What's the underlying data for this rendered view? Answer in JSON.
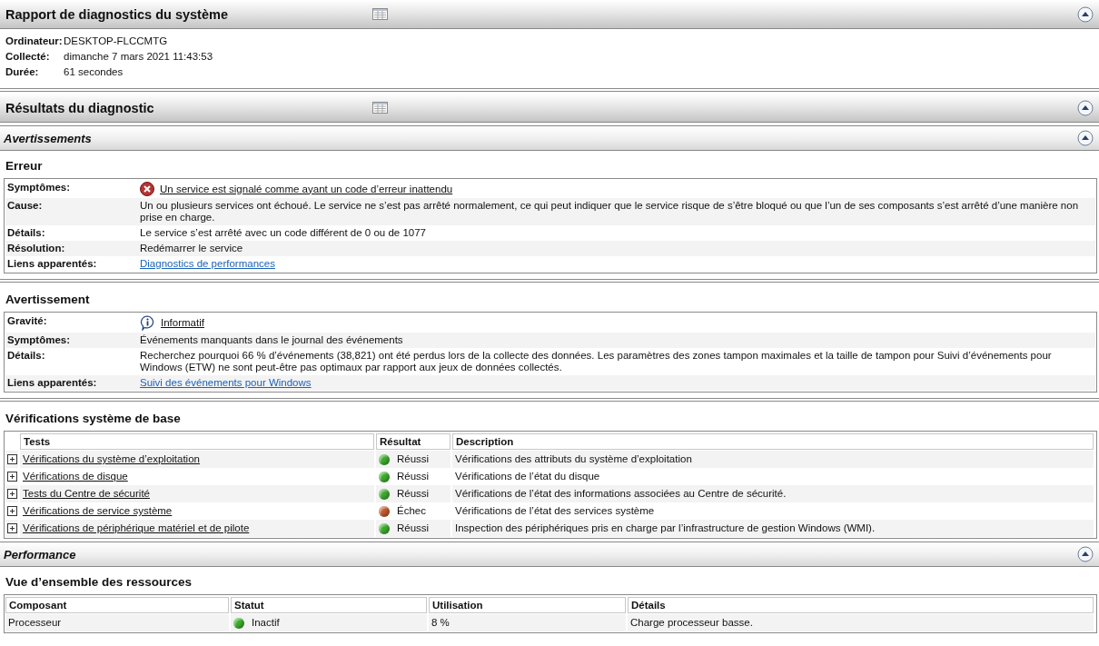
{
  "blocks": [
    {
      "kind": "header",
      "title": "Rapport de diagnostics du système"
    },
    {
      "kind": "info",
      "rows": [
        {
          "label": "Ordinateur:",
          "value": "DESKTOP-FLCCMTG"
        },
        {
          "label": "Collecté:",
          "value": "dimanche 7 mars 2021 11:43:53"
        },
        {
          "label": "Durée:",
          "value": "61 secondes"
        }
      ]
    },
    {
      "kind": "header",
      "title": "Résultats du diagnostic"
    },
    {
      "kind": "subheader",
      "title": "Avertissements"
    },
    {
      "kind": "details",
      "title": "Erreur",
      "rows": [
        {
          "label": "Symptômes:",
          "value": "Un service est signalé comme ayant un code d’erreur inattendu",
          "kind": "error"
        },
        {
          "label": "Cause:",
          "value": "Un ou plusieurs services ont échoué. Le service ne s’est pas arrêté normalement, ce qui peut indiquer que le service risque de s’être bloqué ou que l’un de ses composants s’est arrêté d’une manière non prise en charge.",
          "kind": "text"
        },
        {
          "label": "Détails:",
          "value": "Le service s’est arrêté avec un code différent de 0 ou de 1077",
          "kind": "text"
        },
        {
          "label": "Résolution:",
          "value": "Redémarrer le service",
          "kind": "text"
        },
        {
          "label": "Liens apparentés:",
          "value": "Diagnostics de performances",
          "kind": "link"
        }
      ]
    },
    {
      "kind": "details",
      "title": "Avertissement",
      "rows": [
        {
          "label": "Gravité:",
          "value": "Informatif",
          "kind": "info"
        },
        {
          "label": "Symptômes:",
          "value": "Événements manquants dans le journal des événements",
          "kind": "text"
        },
        {
          "label": "Détails:",
          "value": "Recherchez pourquoi 66 % d’événements (38,821) ont été perdus lors de la collecte des données. Les paramètres des zones tampon maximales et la taille de tampon pour Suivi d’événements pour Windows (ETW) ne sont peut-être pas optimaux par rapport aux jeux de données collectés.",
          "kind": "text"
        },
        {
          "label": "Liens apparentés:",
          "value": "Suivi des événements pour Windows",
          "kind": "link"
        }
      ]
    },
    {
      "kind": "checks",
      "title": "Vérifications système de base",
      "columns": [
        "Tests",
        "Résultat",
        "Description"
      ],
      "rows": [
        {
          "test": "Vérifications du système d’exploitation",
          "result": "Réussi",
          "color": "#3caa2c",
          "description": "Vérifications des attributs du système d’exploitation"
        },
        {
          "test": "Vérifications de disque",
          "result": "Réussi",
          "color": "#3caa2c",
          "description": "Vérifications de l’état du disque"
        },
        {
          "test": "Tests du Centre de sécurité",
          "result": "Réussi",
          "color": "#3caa2c",
          "description": "Vérifications de l’état des informations associées au Centre de sécurité."
        },
        {
          "test": "Vérifications de service système",
          "result": "Échec",
          "color": "#c0582e",
          "description": "Vérifications de l’état des services système"
        },
        {
          "test": "Vérifications de périphérique matériel et de pilote",
          "result": "Réussi",
          "color": "#3caa2c",
          "description": "Inspection des périphériques pris en charge par l’infrastructure de gestion Windows (WMI)."
        }
      ]
    },
    {
      "kind": "subheader",
      "title": "Performance"
    },
    {
      "kind": "resources",
      "title": "Vue d’ensemble des ressources",
      "columns": [
        "Composant",
        "Statut",
        "Utilisation",
        "Détails"
      ],
      "rows": [
        {
          "component": "Processeur",
          "status": "Inactif",
          "color": "#3caa2c",
          "usage": "8 %",
          "details": "Charge processeur basse."
        }
      ]
    }
  ]
}
